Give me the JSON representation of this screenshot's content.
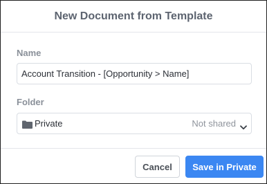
{
  "dialog": {
    "title": "New Document from Template"
  },
  "name_field": {
    "label": "Name",
    "value": "Account Transition - [Opportunity > Name]"
  },
  "folder_field": {
    "label": "Folder",
    "selected_folder": "Private",
    "share_status": "Not shared",
    "icon": "folder-icon"
  },
  "footer": {
    "cancel_label": "Cancel",
    "save_label": "Save in Private"
  },
  "colors": {
    "primary": "#3b87f2",
    "label": "#8a9099",
    "title": "#5d6470"
  }
}
